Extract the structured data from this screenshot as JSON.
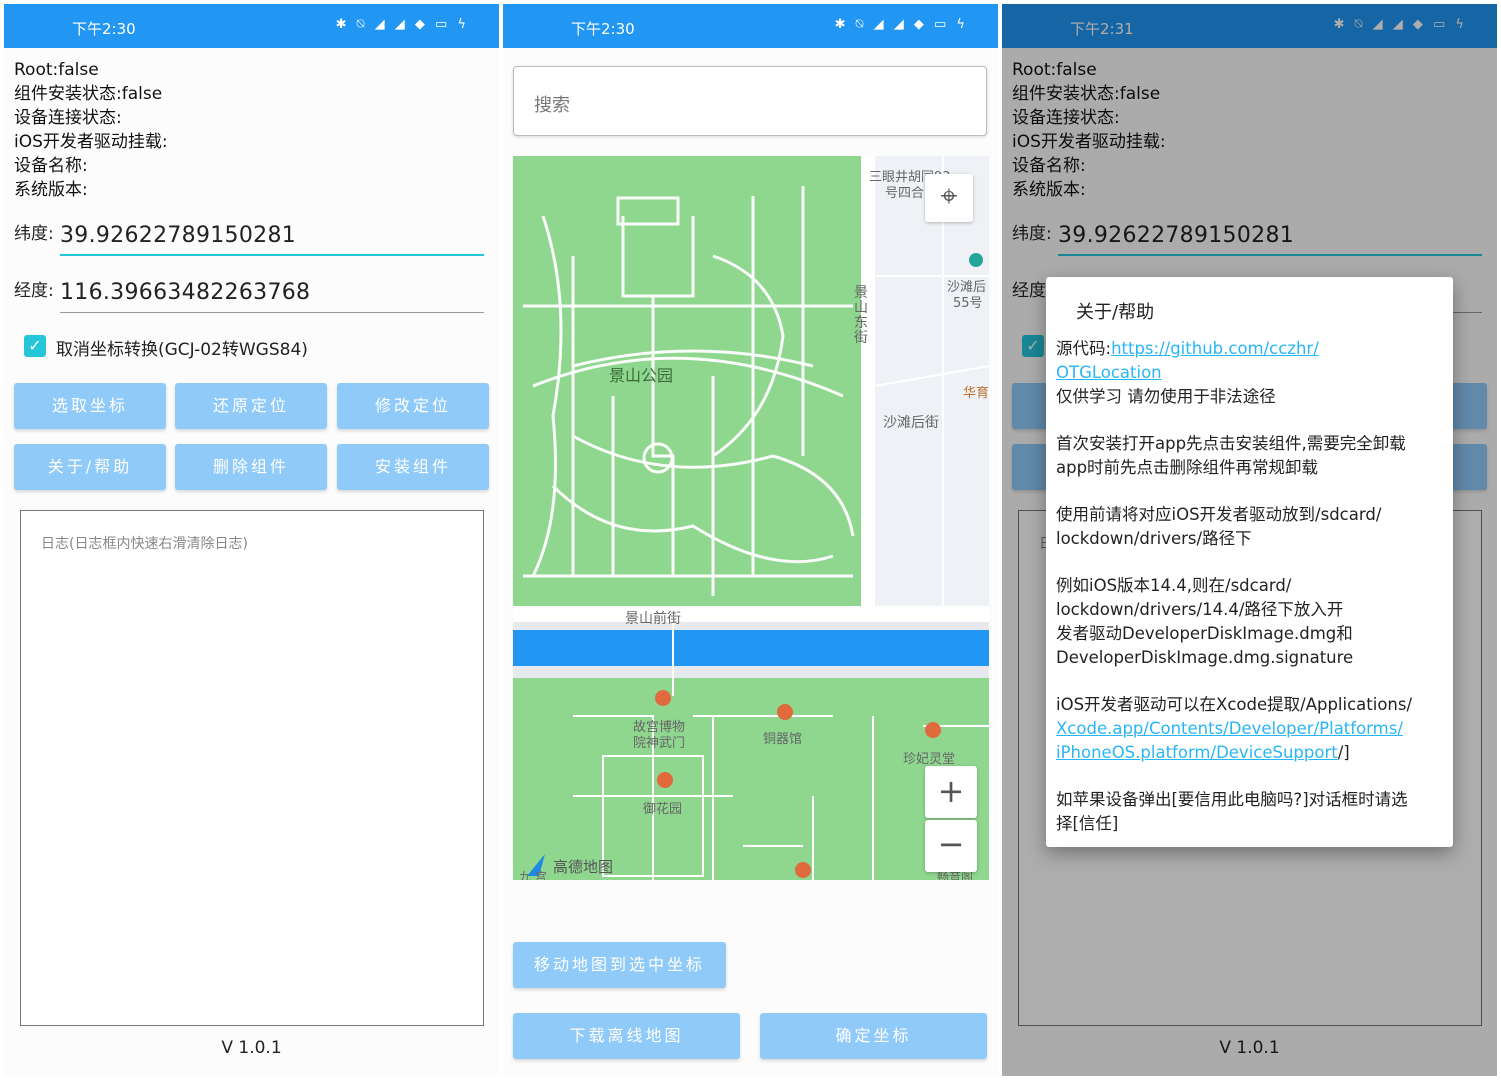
{
  "status": {
    "time1": "下午2:30",
    "time2": "下午2:30",
    "time3": "下午2:31",
    "icons": "✱ ⍉ ◢ ◢ ◆ ▭ ϟ"
  },
  "info": {
    "root": "Root:false",
    "install": "组件安装状态:false",
    "connect": "设备连接状态:",
    "mount": "iOS开发者驱动挂载:",
    "device": "设备名称:",
    "version": "系统版本:"
  },
  "lat": {
    "label": "纬度:",
    "value": "39.92622789150281"
  },
  "lng": {
    "label": "经度:",
    "value": "116.39663482263768",
    "label_short": "经度"
  },
  "checkbox": {
    "mark": "✓",
    "label": "取消坐标转换(GCJ-02转WGS84)"
  },
  "buttons": {
    "pick": "选取坐标",
    "restore": "还原定位",
    "modify": "修改定位",
    "about": "关于/帮助",
    "delete": "删除组件",
    "install": "安装组件"
  },
  "log": {
    "placeholder": "日志(日志框内快速右滑清除日志)",
    "partial": "日"
  },
  "app_version": "V 1.0.1",
  "map": {
    "search_placeholder": "搜索",
    "labels": {
      "jingshan": "景山公园",
      "jingshan_front": "景山前街",
      "shatan_back": "沙滩后街",
      "jingshan_east": "景山东街",
      "sanyanjing": "三眼井胡同93",
      "siheyuan": "号四合院",
      "shatan55": "沙滩后",
      "shatan55b": "55号",
      "huayu": "华育",
      "museum1": "故宫博物",
      "museum2": "院神武门",
      "tongqi": "铜器馆",
      "zhenfei": "珍妃灵堂",
      "yuhua": "御花园",
      "amap": "高德地图",
      "bottom_left": "九 宫",
      "bottom_right": "畅音阁"
    },
    "zoom_in": "+",
    "zoom_out": "−",
    "locate_icon": "⌖"
  },
  "map_buttons": {
    "move": "移动地图到选中坐标",
    "download": "下载离线地图",
    "confirm": "确定坐标"
  },
  "dialog": {
    "title": "关于/帮助",
    "source_label": "源代码:",
    "source_link1": "https://github.com/cczhr/",
    "source_link2": "OTGLocation",
    "warning": "仅供学习 请勿使用于非法途径",
    "p2_1": "首次安装打开app先点击安装组件,需要完全卸载",
    "p2_2": "app时前先点击删除组件再常规卸载",
    "p3_1": "使用前请将对应iOS开发者驱动放到/sdcard/",
    "p3_2": "lockdown/drivers/路径下",
    "p4_1": "例如iOS版本14.4,则在/sdcard/",
    "p4_2": "lockdown/drivers/14.4/路径下放入开",
    "p4_3": "发者驱动DeveloperDiskImage.dmg和",
    "p4_4": "DeveloperDiskImage.dmg.signature",
    "p5_1": "iOS开发者驱动可以在Xcode提取/Applications/",
    "p5_link1": "Xcode.app/Contents/Developer/Platforms/",
    "p5_link2": "iPhoneOS.platform/DeviceSupport",
    "p5_tail": "/]",
    "p6_1": "如苹果设备弹出[要信用此电脑吗?]对话框时请选",
    "p6_2": "择[信任]"
  },
  "colors": {
    "status_bar": "#2196f3",
    "button": "#90caf9",
    "accent": "#26c6da",
    "park": "#8fd68f",
    "water": "#2196f3"
  }
}
